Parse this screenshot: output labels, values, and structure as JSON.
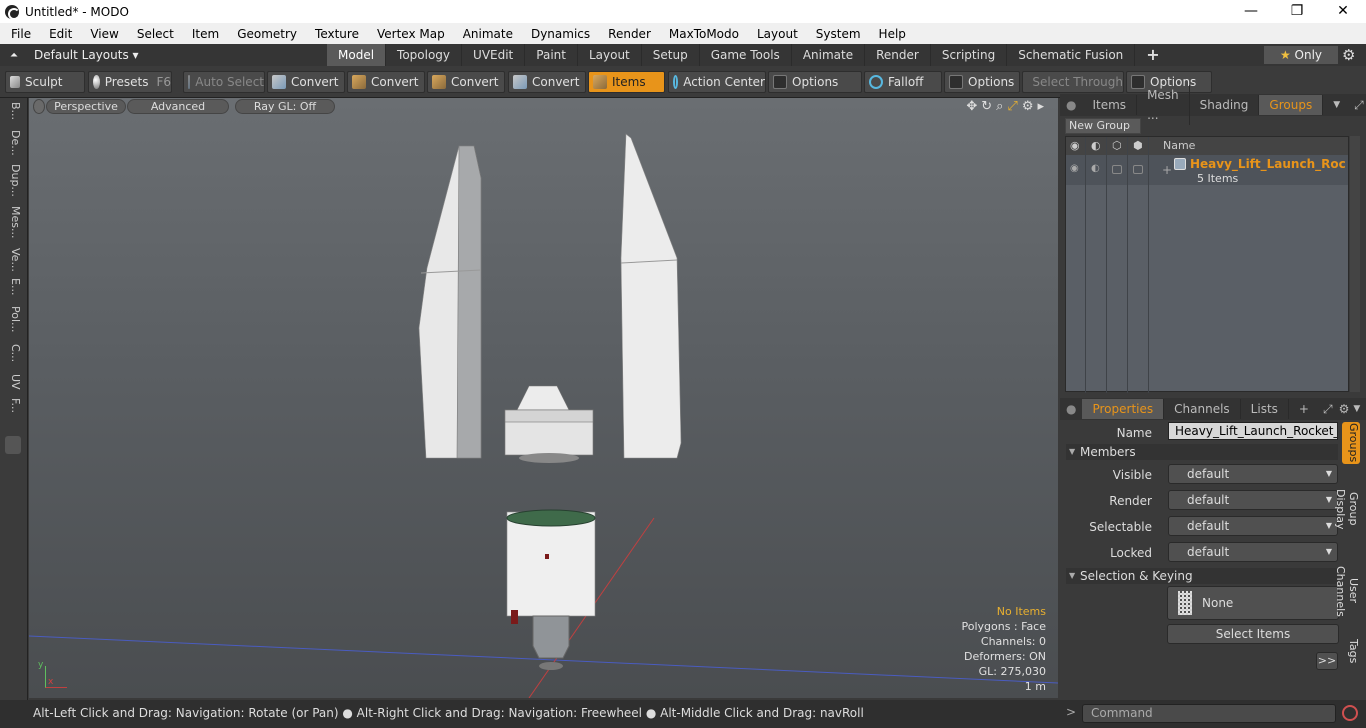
{
  "window": {
    "title": "Untitled* - MODO",
    "min": "—",
    "max": "❐",
    "close": "✕"
  },
  "menu": [
    "File",
    "Edit",
    "View",
    "Select",
    "Item",
    "Geometry",
    "Texture",
    "Vertex Map",
    "Animate",
    "Dynamics",
    "Render",
    "MaxToModo",
    "Layout",
    "System",
    "Help"
  ],
  "layoutbar": {
    "default_layouts": "Default Layouts ▾",
    "tabs": [
      "Model",
      "Topology",
      "UVEdit",
      "Paint",
      "Layout",
      "Setup",
      "Game Tools",
      "Animate",
      "Render",
      "Scripting",
      "Schematic Fusion"
    ],
    "active_tab": "Model",
    "plus": "+",
    "only_label": "Only",
    "star": "★"
  },
  "toolbar": {
    "sculpt": "Sculpt",
    "presets": "Presets",
    "presets_key": "F6",
    "auto_select": "Auto Select",
    "convert": "Convert",
    "items": "Items",
    "action_center": "Action Center",
    "options": "Options",
    "falloff": "Falloff",
    "select_through": "Select Through"
  },
  "lefttabs": [
    "B...",
    "De...",
    "Dup...",
    "Mes...",
    "Ve...",
    "E...",
    "Pol...",
    "C...",
    "UV",
    "F..."
  ],
  "viewport": {
    "perspective": "Perspective",
    "advanced": "Advanced",
    "raygl": "Ray GL: Off",
    "stats": {
      "selection": "No Items",
      "polygons": "Polygons : Face",
      "channels": "Channels: 0",
      "deformers": "Deformers: ON",
      "gl": "GL: 275,030",
      "scale": "1 m"
    },
    "axis_x": "x",
    "axis_y": "y"
  },
  "statusbar": {
    "text": "Alt-Left Click and Drag: Navigation: Rotate (or Pan) ● Alt-Right Click and Drag: Navigation: Freewheel ● Alt-Middle Click and Drag: navRoll"
  },
  "rightpanel": {
    "tabs": [
      "Items",
      "Mesh ...",
      "Shading",
      "Groups"
    ],
    "active_tab": "Groups",
    "new_group": "New Group",
    "list_header": "Name",
    "group": {
      "name": "Heavy_Lift_Launch_Rock...",
      "count": "5 Items"
    },
    "prop_tabs": [
      "Properties",
      "Channels",
      "Lists"
    ],
    "prop_plus": "+",
    "name_label": "Name",
    "name_value": "Heavy_Lift_Launch_Rocket_Stac",
    "members_label": "Members",
    "members": [
      {
        "label": "Visible",
        "value": "default"
      },
      {
        "label": "Render",
        "value": "default"
      },
      {
        "label": "Selectable",
        "value": "default"
      },
      {
        "label": "Locked",
        "value": "default"
      }
    ],
    "selection_label": "Selection & Keying",
    "none_btn": "None",
    "select_items": "Select Items",
    "more": ">>",
    "side_tabs": [
      "Groups",
      "Group Display",
      "User Channels",
      "Tags"
    ],
    "command_placeholder": "Command"
  }
}
